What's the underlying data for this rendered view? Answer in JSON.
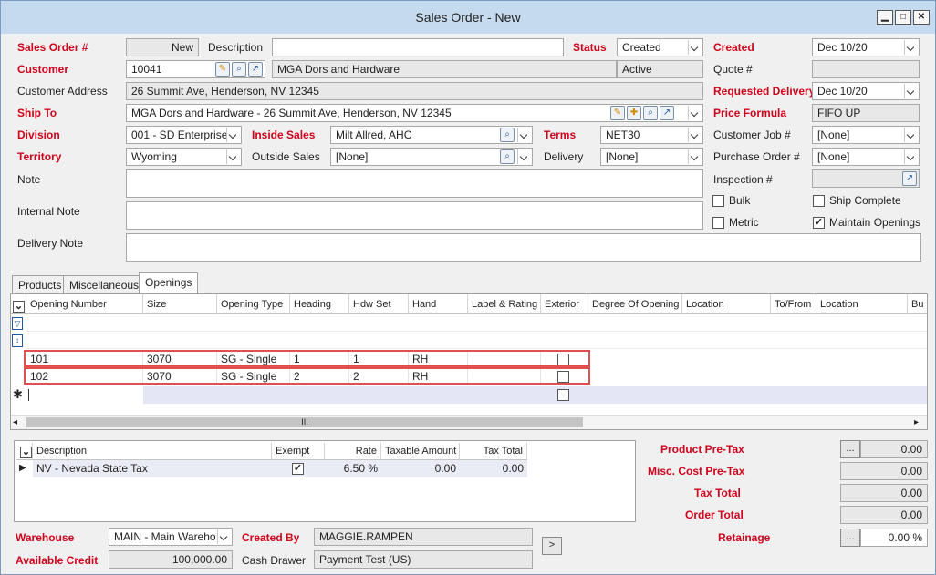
{
  "window": {
    "title": "Sales Order - New"
  },
  "header": {
    "sales_order_label": "Sales Order #",
    "sales_order_value": "New",
    "description_label": "Description",
    "description_value": "",
    "status_label": "Status",
    "status_value": "Created",
    "created_label": "Created",
    "created_value": "Dec 10/20",
    "customer_label": "Customer",
    "customer_id": "10041",
    "customer_name": "MGA Dors and Hardware",
    "customer_status": "Active",
    "quote_label": "Quote #",
    "quote_value": "",
    "customer_address_label": "Customer Address",
    "customer_address_value": "26 Summit Ave, Henderson, NV  12345",
    "requested_delivery_label": "Requested Delivery",
    "requested_delivery_value": "Dec 10/20",
    "ship_to_label": "Ship To",
    "ship_to_value": "MGA Dors and Hardware - 26 Summit Ave, Henderson, NV  12345",
    "price_formula_label": "Price Formula",
    "price_formula_value": "FIFO UP",
    "division_label": "Division",
    "division_value": "001 - SD Enterprise",
    "inside_sales_label": "Inside Sales",
    "inside_sales_value": "Milt Allred, AHC",
    "terms_label": "Terms",
    "terms_value": "NET30",
    "customer_job_label": "Customer Job #",
    "customer_job_value": "[None]",
    "territory_label": "Territory",
    "territory_value": "Wyoming",
    "outside_sales_label": "Outside Sales",
    "outside_sales_value": "[None]",
    "delivery_label": "Delivery",
    "delivery_value": "[None]",
    "purchase_order_label": "Purchase Order #",
    "purchase_order_value": "[None]",
    "note_label": "Note",
    "inspection_label": "Inspection #",
    "internal_note_label": "Internal Note",
    "delivery_note_label": "Delivery Note",
    "bulk_label": "Bulk",
    "ship_complete_label": "Ship Complete",
    "metric_label": "Metric",
    "maintain_openings_label": "Maintain Openings"
  },
  "checks": {
    "bulk": false,
    "ship_complete": false,
    "metric": false,
    "maintain_openings": true
  },
  "tabs": [
    {
      "label": "Products"
    },
    {
      "label": "Miscellaneous"
    },
    {
      "label": "Openings"
    }
  ],
  "openings": {
    "columns": [
      "Opening Number",
      "Size",
      "Opening Type",
      "Heading",
      "Hdw Set",
      "Hand",
      "Label & Rating",
      "Exterior",
      "Degree Of Opening",
      "Location",
      "To/From",
      "Location",
      "Bu"
    ],
    "rows": [
      {
        "number": "101",
        "size": "3070",
        "type": "SG - Single",
        "heading": "1",
        "hdw_set": "1",
        "hand": "RH",
        "exterior": false
      },
      {
        "number": "102",
        "size": "3070",
        "type": "SG - Single",
        "heading": "2",
        "hdw_set": "2",
        "hand": "RH",
        "exterior": false
      }
    ],
    "scroll_glyph": "III"
  },
  "tax": {
    "columns": [
      "Description",
      "Exempt",
      "Rate",
      "Taxable Amount",
      "Tax Total"
    ],
    "rows": [
      {
        "description": "NV - Nevada State Tax",
        "exempt": true,
        "rate": "6.50 %",
        "taxable_amount": "0.00",
        "tax_total": "0.00"
      }
    ]
  },
  "footer": {
    "warehouse_label": "Warehouse",
    "warehouse_value": "MAIN - Main Wareho",
    "created_by_label": "Created By",
    "created_by_value": "MAGGIE.RAMPEN",
    "available_credit_label": "Available Credit",
    "available_credit_value": "100,000.00",
    "cash_drawer_label": "Cash Drawer",
    "cash_drawer_value": "Payment Test (US)",
    "arrow_label": ">"
  },
  "totals": {
    "product_pretax_label": "Product Pre-Tax",
    "product_pretax_value": "0.00",
    "misc_cost_label": "Misc. Cost Pre-Tax",
    "misc_cost_value": "0.00",
    "tax_total_label": "Tax Total",
    "tax_total_value": "0.00",
    "order_total_label": "Order Total",
    "order_total_value": "0.00",
    "retainage_label": "Retainage",
    "retainage_value": "0.00 %",
    "ellipsis_label": "..."
  },
  "colors": {
    "required_label": "#d0021b",
    "highlight_border": "#e05050",
    "title_bar": "#c5d9ef"
  }
}
